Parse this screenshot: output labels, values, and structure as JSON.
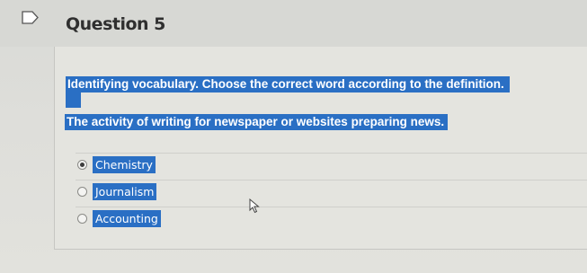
{
  "question": {
    "title": "Question 5",
    "instruction": "Identifying vocabulary. Choose the correct word according to the definition.",
    "prompt": "The activity of writing for newspaper or websites preparing news.",
    "options": [
      {
        "label": "Chemistry",
        "selected": true
      },
      {
        "label": "Journalism",
        "selected": false
      },
      {
        "label": "Accounting",
        "selected": false
      }
    ]
  },
  "icons": {
    "flag": "flag-outline-icon",
    "cursor": "mouse-pointer-icon"
  },
  "colors": {
    "highlight": "#2a6fc4",
    "background": "#e2e2dd"
  }
}
